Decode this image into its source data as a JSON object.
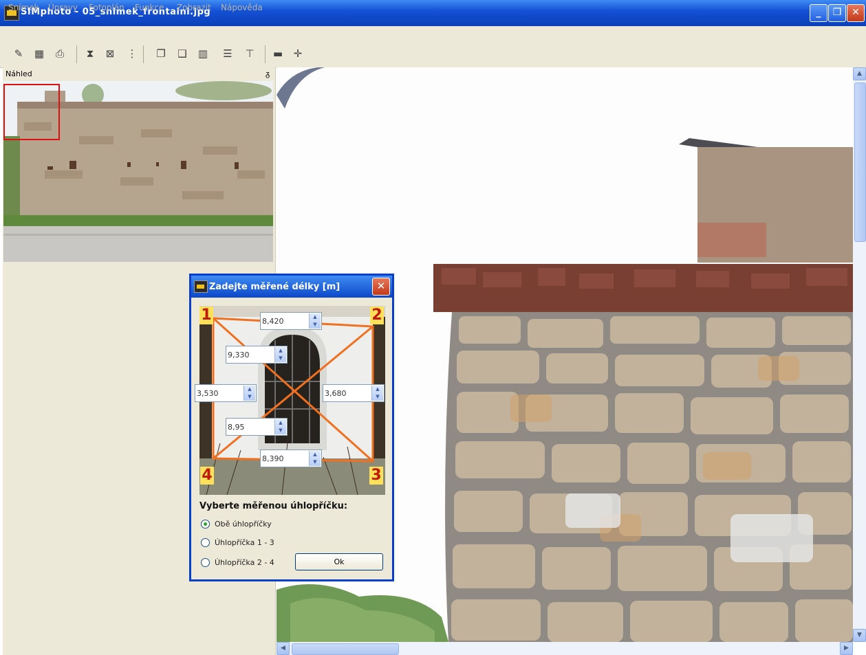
{
  "window": {
    "title": "SIMphoto - 05_snimek_frontalni.jpg",
    "controls": {
      "minimize": "_",
      "maximize": "❐",
      "close": "✕"
    }
  },
  "menubar": {
    "items": [
      "Snímek",
      "Úpravy",
      "Fotoplán",
      "Funkce",
      "Zobrazit",
      "Nápověda"
    ]
  },
  "toolbar": {
    "icons": [
      "open-icon",
      "save-icon",
      "print-icon",
      "hourglass-icon",
      "transform-icon",
      "points-icon",
      "copy-icon",
      "paste-icon",
      "grid-icon",
      "lines-icon",
      "measure-icon",
      "rectangle-icon",
      "crosshair-icon"
    ]
  },
  "preview_panel": {
    "title": "Náhled",
    "pin": "ᵹ"
  },
  "dialog": {
    "title": "Zadejte měřené délky [m]",
    "close": "✕",
    "corners": [
      "1",
      "2",
      "3",
      "4"
    ],
    "fields": {
      "top": "8,420",
      "diag_1_3": "9,330",
      "left": "3,530",
      "right": "3,680",
      "diag_2_4": "8,95",
      "bottom": "8,390"
    },
    "question": "Vyberte měřenou úhlopříčku:",
    "options": [
      "Obě úhlopříčky",
      "Úhlopříčka 1 - 3",
      "Úhlopříčka 2 - 4"
    ],
    "selected_option": "Obě úhlopříčky",
    "ok_label": "Ok"
  }
}
